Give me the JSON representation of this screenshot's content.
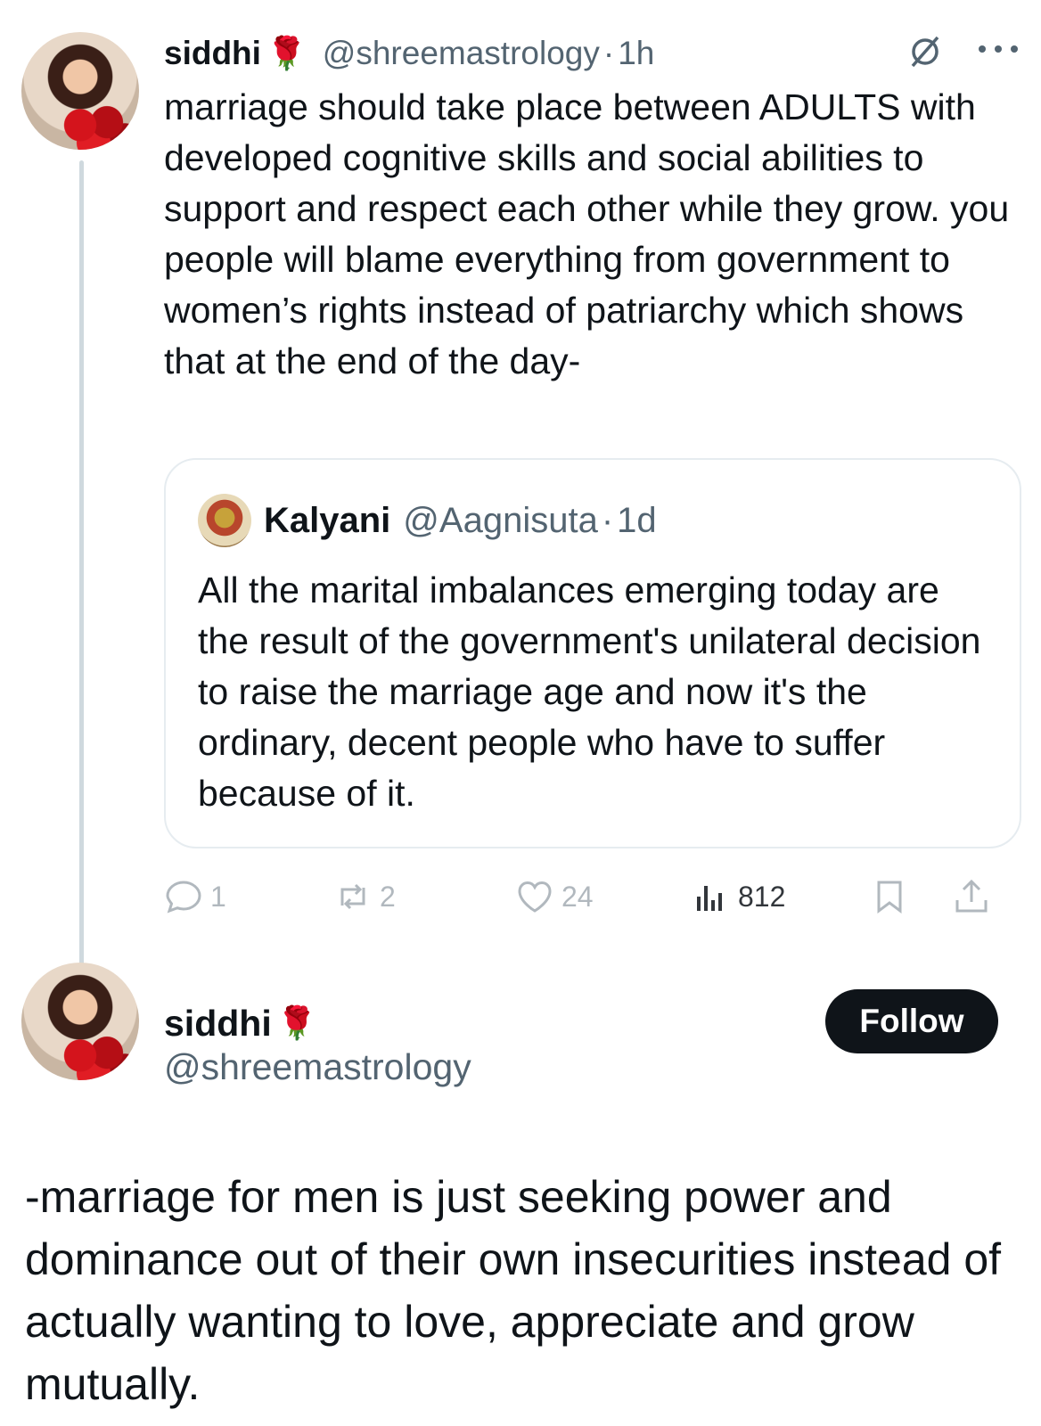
{
  "tweet1": {
    "name": "siddhi",
    "rose": "🌹",
    "handle": "@shreemastrology",
    "separator": "·",
    "time": "1h",
    "text": "marriage should take place between ADULTS with developed cognitive skills and social abilities to support and respect each other while they grow. you people will blame everything from government to women’s rights instead of patriarchy which shows that at the end of the day-",
    "quote": {
      "name": "Kalyani",
      "handle": "@Aagnisuta",
      "separator": "·",
      "time": "1d",
      "text": "All the marital imbalances emerging today are the result of the government's unilateral decision to raise the marriage age and now it's the ordinary, decent people who have to suffer because of it."
    },
    "actions": {
      "replies": "1",
      "reposts": "2",
      "likes": "24",
      "views": "812"
    }
  },
  "tweet2": {
    "name": "siddhi",
    "rose": "🌹",
    "handle": "@shreemastrology",
    "follow_label": "Follow",
    "text": "-marriage for men is just seeking power and dominance out of their own insecurities instead of actually wanting to love, appreciate and grow mutually."
  },
  "icons": {
    "grok": "grok-icon",
    "more": "more-icon",
    "reply": "reply-icon",
    "repost": "repost-icon",
    "like": "heart-icon",
    "views": "views-icon",
    "bookmark": "bookmark-icon",
    "share": "share-icon"
  },
  "colors": {
    "text": "#0f1419",
    "secondary": "#536471",
    "thread_line": "#cfd9de",
    "follow_bg": "#0f1419"
  }
}
